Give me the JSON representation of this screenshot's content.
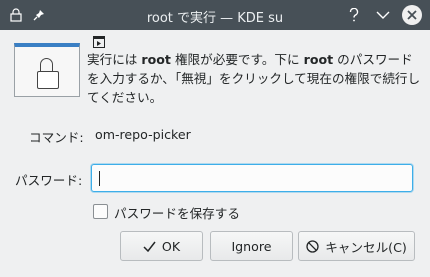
{
  "window": {
    "title": "root で実行 — KDE su",
    "app_icon": "lock-icon",
    "pin_icon": "pin-icon",
    "buttons": [
      "help-icon",
      "minimize-icon",
      "close-icon"
    ]
  },
  "message": {
    "part1": "実行には ",
    "root1": "root",
    "part2": " 権限が必要です。下に ",
    "root2": "root",
    "part3": " のパスワードを入力するか、「無視」をクリックして現在の権限で続行してください。"
  },
  "command": {
    "label": "コマンド:",
    "value": "om-repo-picker"
  },
  "password": {
    "label": "パスワード:",
    "value": ""
  },
  "save_password": {
    "label": "パスワードを保存する",
    "checked": false
  },
  "buttons": {
    "ok": "OK",
    "ignore": "Ignore",
    "cancel": "キャンセル(C)"
  },
  "colors": {
    "titlebar": "#475057",
    "focus": "#3daee9",
    "background": "#eff0f1"
  }
}
